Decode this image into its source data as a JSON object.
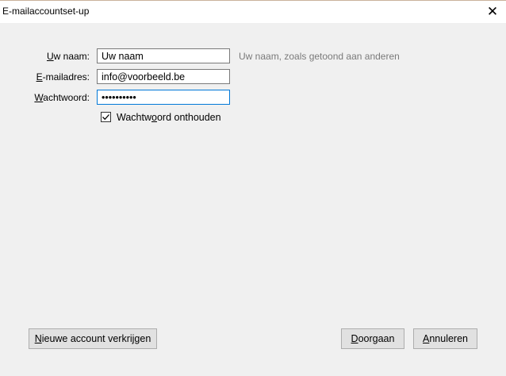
{
  "window": {
    "title": "E-mailaccountset-up",
    "close_glyph": "✕"
  },
  "form": {
    "name": {
      "label_key": "U",
      "label_rest": "w naam:",
      "value": "Uw naam",
      "hint": "Uw naam, zoals getoond aan anderen"
    },
    "email": {
      "label_key": "E",
      "label_rest": "-mailadres:",
      "value": "info@voorbeeld.be"
    },
    "password": {
      "label_key": "W",
      "label_rest": "achtwoord:",
      "value": "••••••••••"
    },
    "remember": {
      "checked": true,
      "label_pre": "Wachtw",
      "label_key": "o",
      "label_post": "ord onthouden"
    }
  },
  "buttons": {
    "new_account": {
      "key": "N",
      "rest": "ieuwe account verkrijgen"
    },
    "continue": {
      "key": "D",
      "rest": "oorgaan"
    },
    "cancel": {
      "key": "A",
      "rest": "nnuleren"
    }
  },
  "colors": {
    "accent": "#0078d7",
    "hint": "#7a7a7a",
    "background": "#f0f0f0"
  },
  "icons": {
    "close": "close-icon",
    "check": "checkmark-icon"
  }
}
